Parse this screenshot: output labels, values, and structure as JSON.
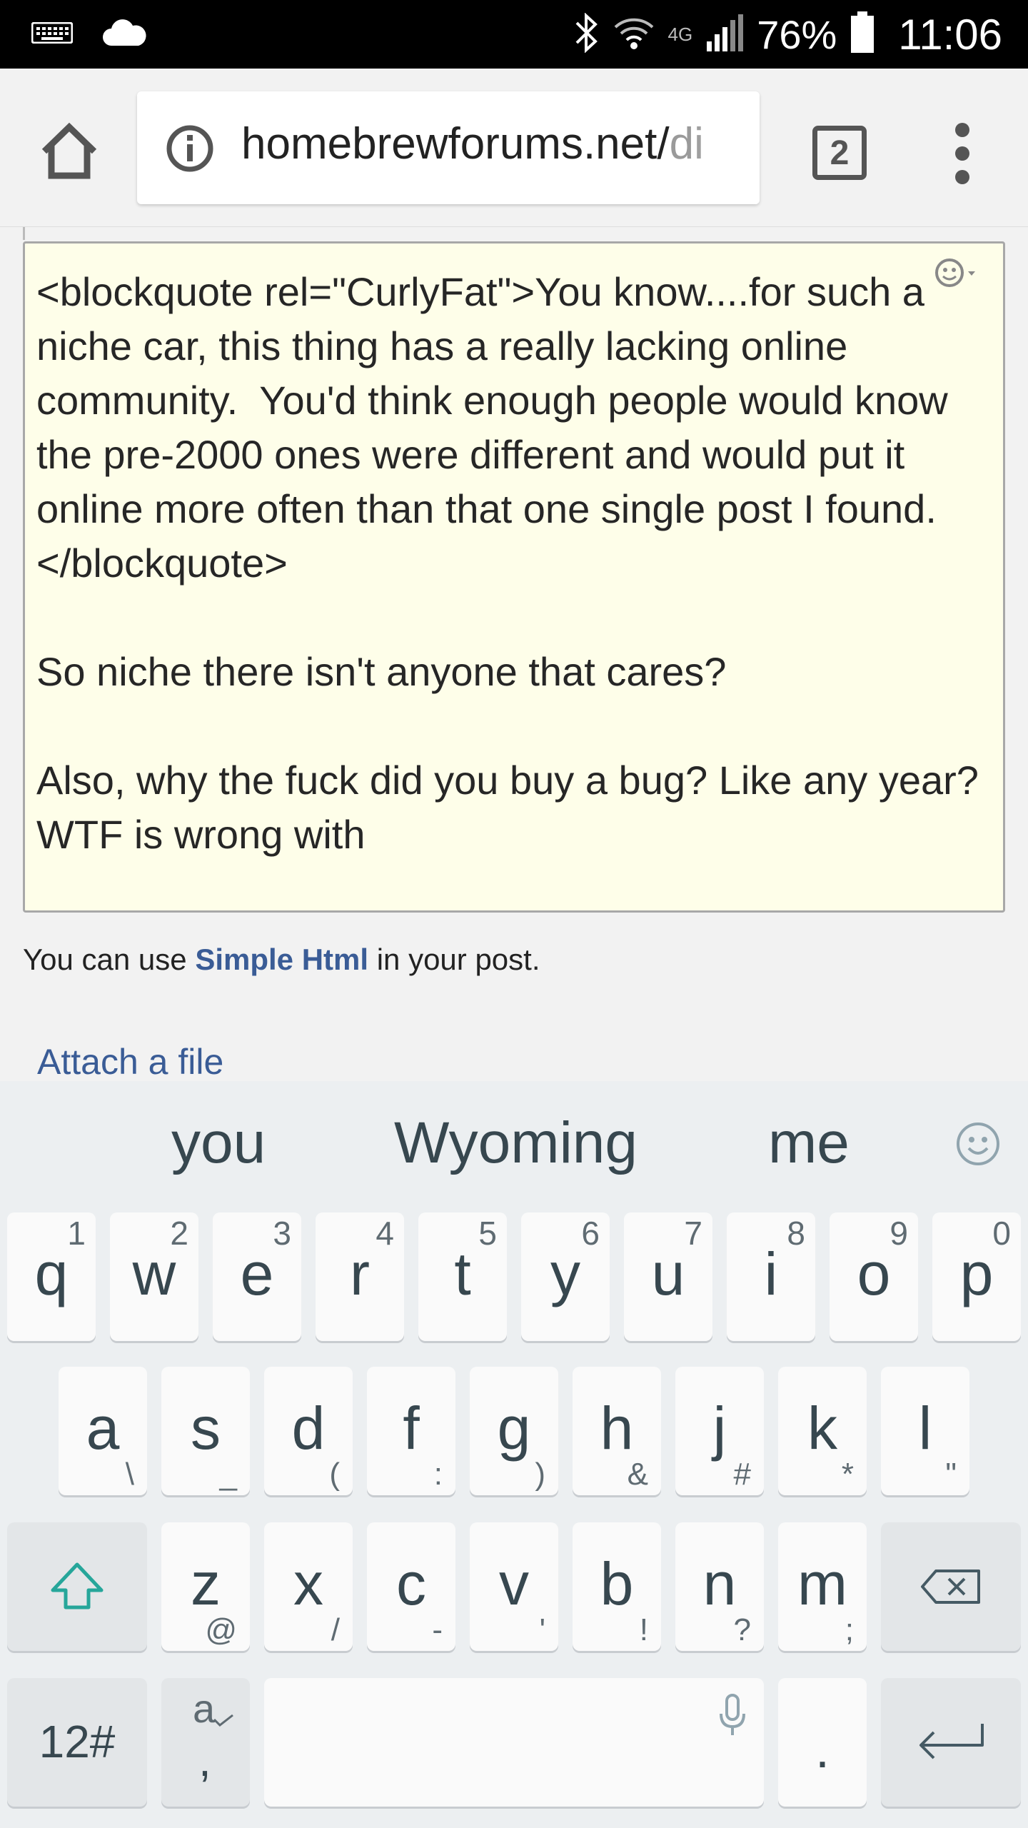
{
  "status_bar": {
    "network": "4G",
    "battery": "76%",
    "time": "11:06"
  },
  "browser": {
    "url_main": "homebrewforums.net/",
    "url_tail": "di",
    "tab_count": "2"
  },
  "post_editor": {
    "content": "<blockquote rel=\"CurlyFat\">You know....for such a niche car, this thing has a really lacking online community.  You'd think enough people would know the pre-2000 ones were different and would put it online more often than that one single post I found. </blockquote>\n\nSo niche there isn't anyone that cares?\n\nAlso, why the fuck did you buy a bug? Like any year? WTF is wrong with"
  },
  "hint": {
    "prefix": "You can use ",
    "link": "Simple Html",
    "suffix": " in your post."
  },
  "attach_label": "Attach a file",
  "keyboard": {
    "suggestions": [
      "you",
      "Wyoming",
      "me"
    ],
    "row1": [
      {
        "key": "q",
        "alt": "1"
      },
      {
        "key": "w",
        "alt": "2"
      },
      {
        "key": "e",
        "alt": "3"
      },
      {
        "key": "r",
        "alt": "4"
      },
      {
        "key": "t",
        "alt": "5"
      },
      {
        "key": "y",
        "alt": "6"
      },
      {
        "key": "u",
        "alt": "7"
      },
      {
        "key": "i",
        "alt": "8"
      },
      {
        "key": "o",
        "alt": "9"
      },
      {
        "key": "p",
        "alt": "0"
      }
    ],
    "row2": [
      {
        "key": "a",
        "alt": "\\"
      },
      {
        "key": "s",
        "alt": "_"
      },
      {
        "key": "d",
        "alt": "("
      },
      {
        "key": "f",
        "alt": ":"
      },
      {
        "key": "g",
        "alt": ")"
      },
      {
        "key": "h",
        "alt": "&"
      },
      {
        "key": "j",
        "alt": "#"
      },
      {
        "key": "k",
        "alt": "*"
      },
      {
        "key": "l",
        "alt": "\""
      }
    ],
    "row3": [
      {
        "key": "z",
        "alt": "@"
      },
      {
        "key": "x",
        "alt": "/"
      },
      {
        "key": "c",
        "alt": "-"
      },
      {
        "key": "v",
        "alt": "'"
      },
      {
        "key": "b",
        "alt": "!"
      },
      {
        "key": "n",
        "alt": "?"
      },
      {
        "key": "m",
        "alt": ";"
      }
    ],
    "symbols_label": "12#",
    "lang_key_top": "a",
    "lang_key_bottom": ",",
    "period_label": ".",
    "accent_color": "#26a69a"
  }
}
